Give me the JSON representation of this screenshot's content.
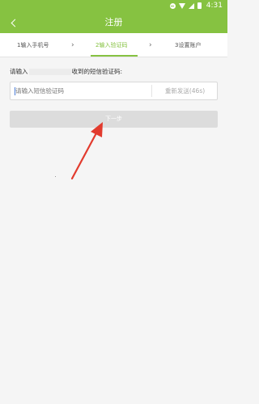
{
  "status_bar": {
    "time": "4:31",
    "icons": [
      "do-not-disturb-icon",
      "wifi-icon",
      "signal-icon",
      "battery-icon"
    ]
  },
  "header": {
    "title": "注册",
    "back_icon": "chevron-left-icon",
    "background_color": "#86c241"
  },
  "steps": [
    {
      "label": "1输入手机号",
      "active": false
    },
    {
      "label": "2输入验证码",
      "active": true
    },
    {
      "label": "3设置账户",
      "active": false
    }
  ],
  "step_separator": "›",
  "prompt": {
    "prefix": "请输入",
    "suffix": "收到的短信验证码:"
  },
  "code_input": {
    "value": "",
    "placeholder": "请输入短信验证码"
  },
  "resend_label": "重新发送(46s)",
  "next_button": {
    "label": "下一步",
    "enabled": false
  },
  "annotation": {
    "color": "#e23b2e",
    "icon": "red-arrow-annotation"
  },
  "colors": {
    "accent": "#86c241",
    "background": "#f5f5f5",
    "disabled_button": "#dcdcdc"
  }
}
